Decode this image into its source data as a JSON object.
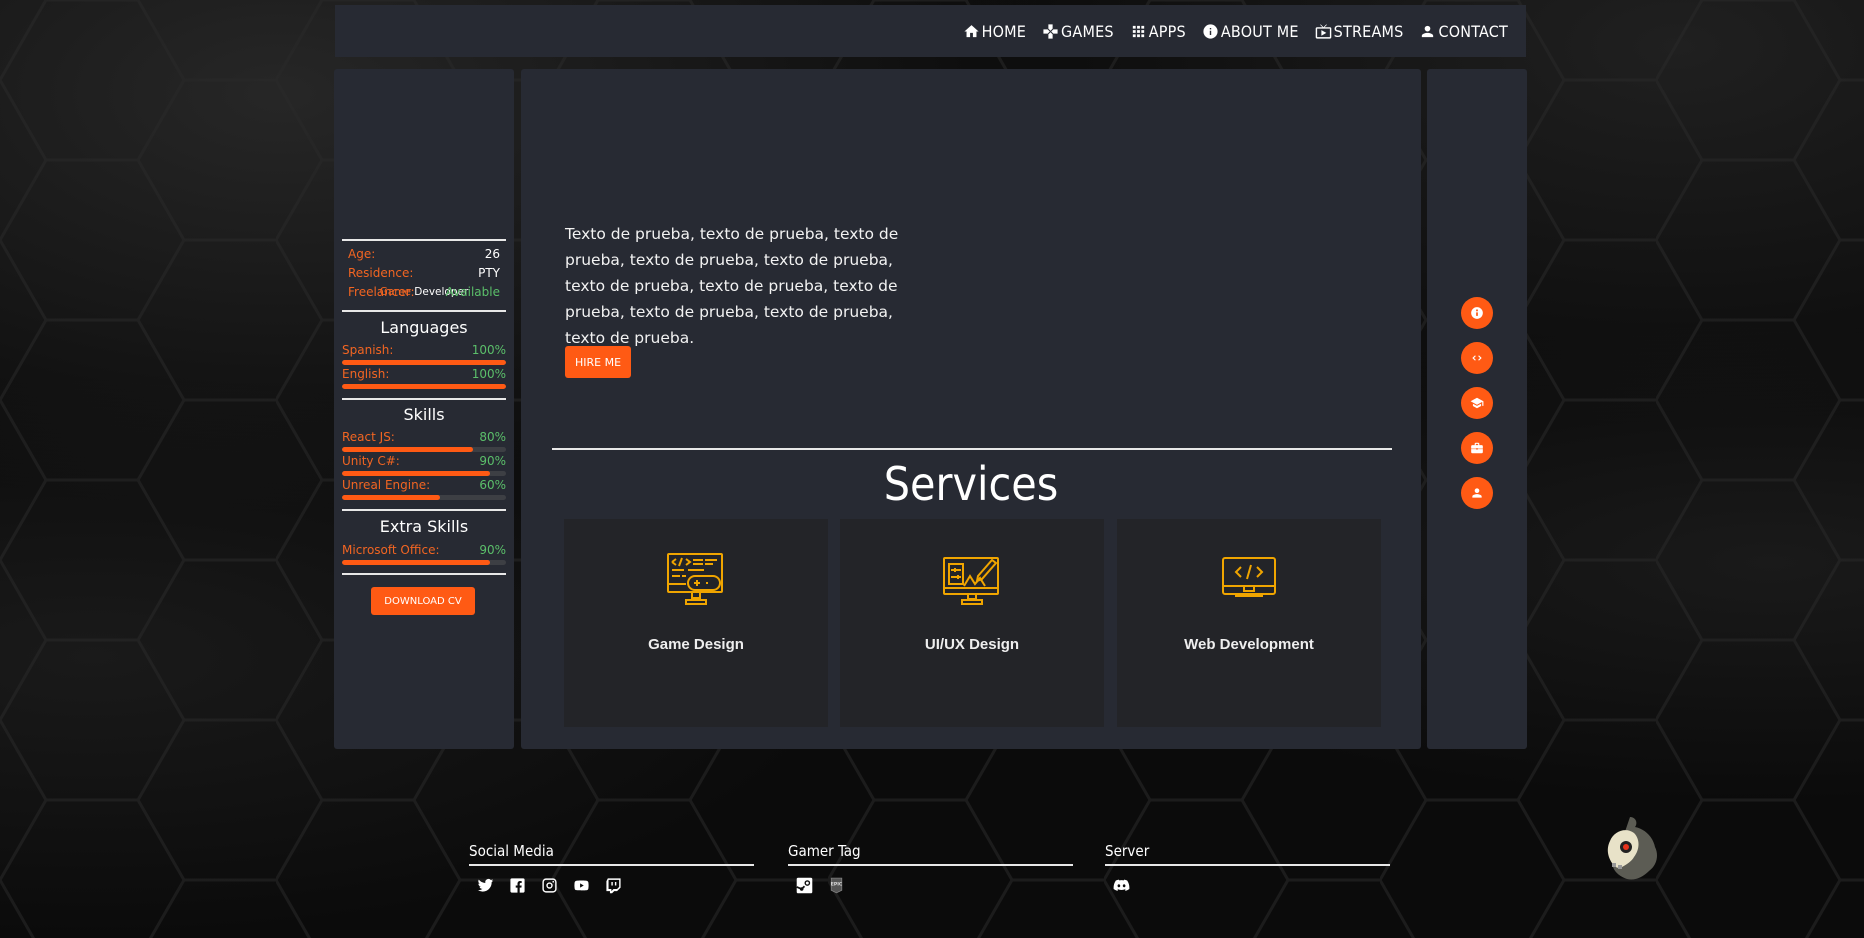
{
  "nav": {
    "items": [
      {
        "label": "HOME",
        "icon": "home-icon"
      },
      {
        "label": "GAMES",
        "icon": "gamepad-icon"
      },
      {
        "label": "APPS",
        "icon": "apps-grid-icon"
      },
      {
        "label": "ABOUT ME",
        "icon": "info-icon"
      },
      {
        "label": "STREAMS",
        "icon": "tv-play-icon"
      },
      {
        "label": "CONTACT",
        "icon": "person-icon"
      }
    ]
  },
  "profile": {
    "role_accent": "Game",
    "role_rest": "Developer",
    "info": [
      {
        "label": "Age:",
        "value": "26"
      },
      {
        "label": "Residence:",
        "value": "PTY"
      },
      {
        "label": "Freelancer:",
        "value": "Available"
      }
    ],
    "languages": {
      "title": "Languages",
      "items": [
        {
          "label": "Spanish:",
          "percent_text": "100%",
          "percent": 100
        },
        {
          "label": "English:",
          "percent_text": "100%",
          "percent": 100
        }
      ]
    },
    "skills": {
      "title": "Skills",
      "items": [
        {
          "label": "React JS:",
          "percent_text": "80%",
          "percent": 80
        },
        {
          "label": "Unity C#:",
          "percent_text": "90%",
          "percent": 90
        },
        {
          "label": "Unreal Engine:",
          "percent_text": "60%",
          "percent": 60
        }
      ]
    },
    "extra_skills": {
      "title": "Extra Skills",
      "items": [
        {
          "label": "Microsoft Office:",
          "percent_text": "90%",
          "percent": 90
        }
      ]
    },
    "download_label": "DOWNLOAD CV"
  },
  "main": {
    "intro_text": "Texto de prueba, texto de prueba, texto de prueba, texto de prueba, texto de prueba, texto de prueba, texto de prueba, texto de prueba, texto de prueba, texto de prueba, texto de prueba.",
    "hire_label": "HIRE ME",
    "services_title": "Services",
    "services": [
      {
        "title": "Game Design",
        "icon": "monitor-gamepad-icon"
      },
      {
        "title": "UI/UX Design",
        "icon": "monitor-design-icon"
      },
      {
        "title": "Web Development",
        "icon": "monitor-code-icon"
      }
    ]
  },
  "side_nav": [
    {
      "icon": "info-icon"
    },
    {
      "icon": "code-icon"
    },
    {
      "icon": "graduation-cap-icon"
    },
    {
      "icon": "briefcase-icon"
    },
    {
      "icon": "person-icon"
    }
  ],
  "footer": {
    "social_title": "Social Media",
    "social_icons": [
      "twitter-icon",
      "facebook-icon",
      "instagram-icon",
      "youtube-icon",
      "twitch-icon"
    ],
    "gamer_title": "Gamer Tag",
    "gamer_icons": [
      "steam-icon",
      "epic-games-icon"
    ],
    "server_title": "Server",
    "server_icons": [
      "discord-icon"
    ]
  },
  "colors": {
    "accent": "#ff5a14",
    "accent_text": "#f26522",
    "success": "#5bbf6a",
    "icon_gold": "#f0a500",
    "panel": "#272a33",
    "card": "#232428"
  }
}
